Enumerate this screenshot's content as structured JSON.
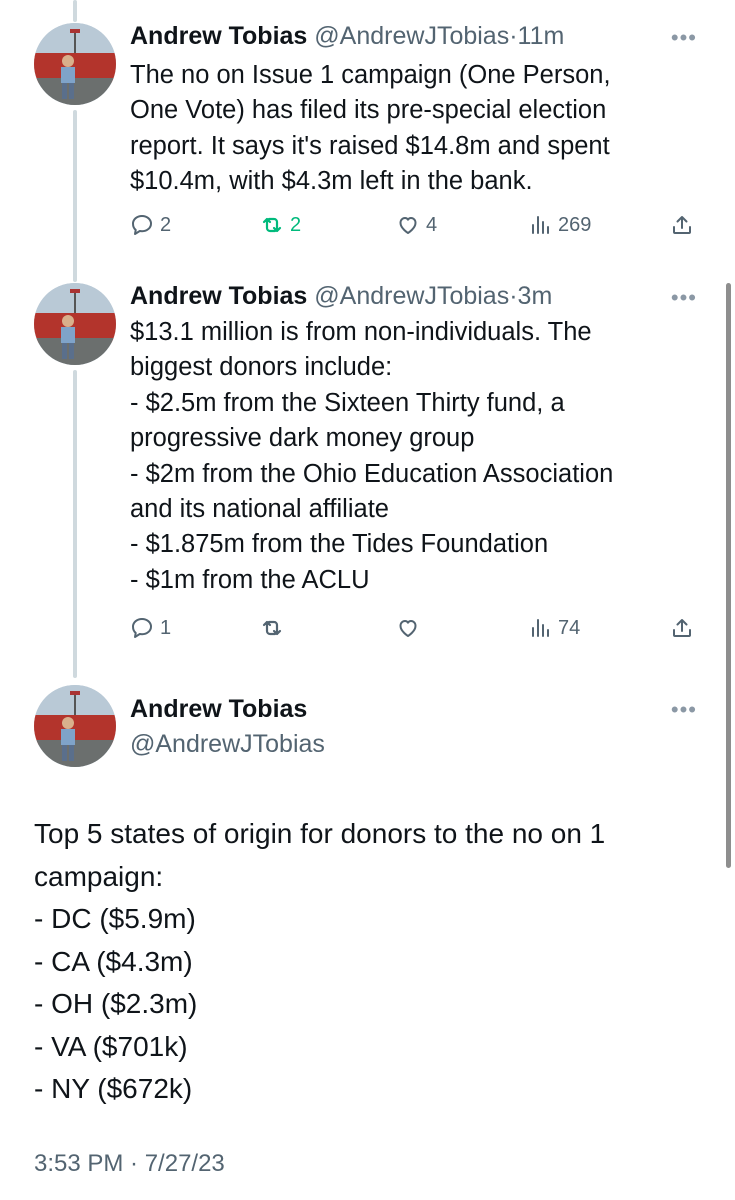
{
  "tweets": [
    {
      "name": "Andrew Tobias",
      "handle": "@AndrewJTobias",
      "separator": "·",
      "time": "11m",
      "text_lines": [
        "The no on Issue 1 campaign (One Person,",
        "One Vote) has filed its pre-special election",
        "report.   It says it's raised $14.8m and spent",
        "$10.4m, with $4.3m left in the bank."
      ],
      "replies": "2",
      "retweets": "2",
      "likes": "4",
      "views": "269"
    },
    {
      "name": "Andrew Tobias",
      "handle": "@AndrewJTobias",
      "separator": "·",
      "time": "3m",
      "text_lines": [
        "$13.1 million is from non-individuals. The",
        "biggest donors include:",
        "- $2.5m from the Sixteen Thirty fund, a",
        "progressive dark money group",
        "- $2m from the Ohio Education Association",
        "and its national affiliate",
        "- $1.875m from the Tides Foundation",
        "- $1m from the ACLU"
      ],
      "replies": "1",
      "retweets": "",
      "likes": "",
      "views": "74"
    }
  ],
  "main_tweet": {
    "name": "Andrew Tobias",
    "handle": "@AndrewJTobias",
    "text_lines": [
      "Top 5 states of origin for donors to the no on 1",
      "campaign:",
      "- DC ($5.9m)",
      "- CA ($4.3m)",
      "- OH ($2.3m)",
      "- VA ($701k)",
      "- NY ($672k)"
    ],
    "timestamp": "3:53 PM · 7/27/23"
  },
  "icons": {
    "more": "more-horizontal-icon",
    "reply": "reply-bubble-icon",
    "retweet": "retweet-icon",
    "like": "heart-icon",
    "views": "views-bar-chart-icon",
    "share": "share-icon"
  },
  "colors": {
    "text": "#0f1419",
    "muted": "#536471",
    "retweet_active": "#00ba7c",
    "thread_line": "#cfd9de"
  }
}
